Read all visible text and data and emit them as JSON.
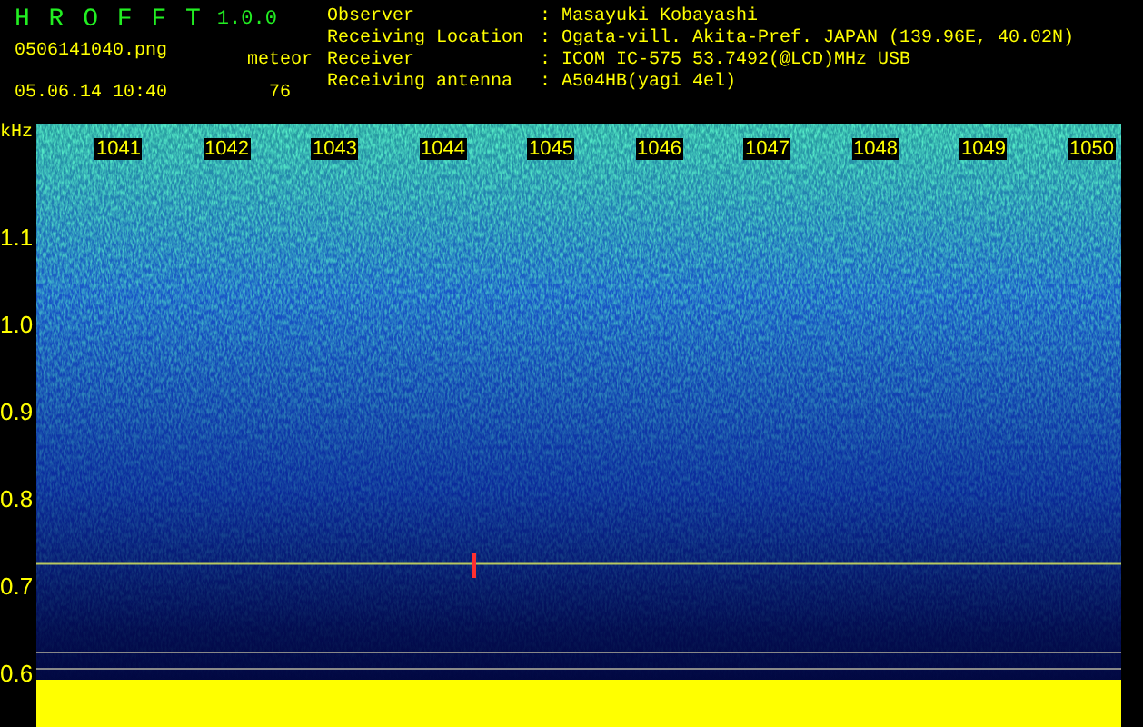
{
  "app": {
    "title": "H R O F F T",
    "version": "1.0.0"
  },
  "file": {
    "name": "0506141040.png",
    "timestamp": "05.06.14 10:40"
  },
  "meteor": {
    "label": "meteor",
    "count": "76"
  },
  "station": [
    {
      "label": "Observer",
      "value": "Masayuki Kobayashi"
    },
    {
      "label": "Receiving Location",
      "value": "Ogata-vill. Akita-Pref. JAPAN (139.96E, 40.02N)"
    },
    {
      "label": "Receiver",
      "value": "ICOM IC-575 53.7492(@LCD)MHz USB"
    },
    {
      "label": "Receiving antenna",
      "value": "A504HB(yagi 4el)"
    }
  ],
  "separator": ":",
  "spectrogram": {
    "y_unit": "kHz",
    "y_labels": [
      "1.1",
      "1.0",
      "0.9",
      "0.8",
      "0.7",
      "0.6"
    ],
    "time_labels": [
      "1041",
      "1042",
      "1043",
      "1044",
      "1045",
      "1046",
      "1047",
      "1048",
      "1049",
      "1050"
    ]
  }
}
